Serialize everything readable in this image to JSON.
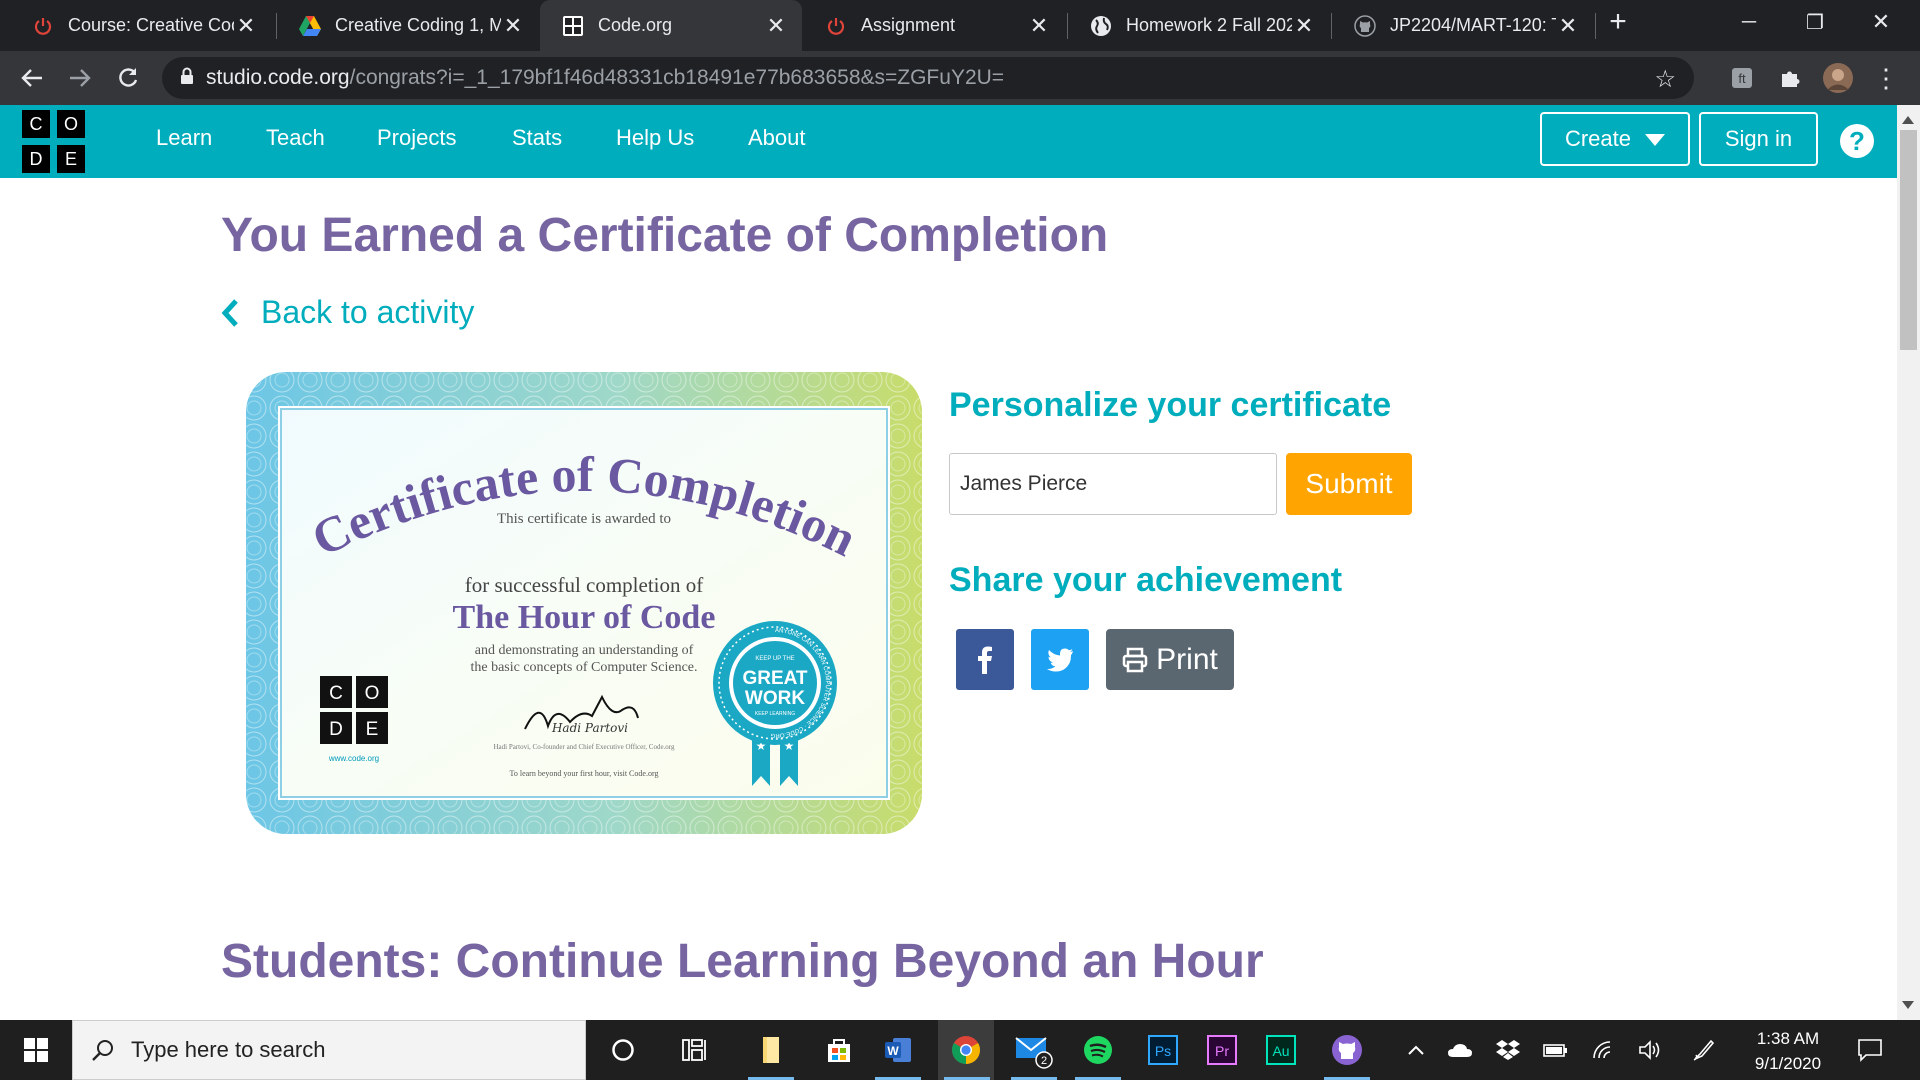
{
  "browser": {
    "tabs": [
      {
        "title": "Course: Creative Cod",
        "icon": "power-icon"
      },
      {
        "title": "Creative Coding 1, M",
        "icon": "google-drive-icon"
      },
      {
        "title": "Code.org",
        "icon": "code-org-icon",
        "active": true
      },
      {
        "title": "Assignment",
        "icon": "power-icon"
      },
      {
        "title": "Homework 2 Fall 202",
        "icon": "globe-icon"
      },
      {
        "title": "JP2204/MART-120: T",
        "icon": "github-icon"
      }
    ],
    "url_host": "studio.code.org",
    "url_path": "/congrats?i=_1_179bf1f46d48331cb18491e77b683658&s=ZGFuY2U="
  },
  "site": {
    "logo_letters": [
      "C",
      "O",
      "D",
      "E"
    ],
    "nav": [
      "Learn",
      "Teach",
      "Projects",
      "Stats",
      "Help Us",
      "About"
    ],
    "create_label": "Create",
    "signin_label": "Sign in",
    "help_label": "?"
  },
  "page": {
    "title": "You Earned a Certificate of Completion",
    "back_label": "Back to activity",
    "certificate": {
      "heading": "Certificate of Completion",
      "awarded": "This certificate is awarded to",
      "for_completion": "for successful completion of",
      "course": "The Hour of Code",
      "demonstrating": "and demonstrating an understanding of",
      "concepts": "the basic concepts of Computer Science.",
      "signature": "Hadi Partovi",
      "signer": "Hadi Partovi, Co-founder and Chief Executive Officer, Code.org",
      "learn_more": "To learn beyond your first hour, visit Code.org",
      "website": "www.code.org",
      "badge_top": "KEEP UP THE",
      "badge_main1": "GREAT",
      "badge_main2": "WORK",
      "badge_bottom": "KEEP LEARNING",
      "badge_ring": "ANYONE CAN LEARN COMPUTER SCIENCE · CODE.ORG"
    },
    "personalize_heading": "Personalize your certificate",
    "name_value": "James Pierce",
    "submit_label": "Submit",
    "share_heading": "Share your achievement",
    "print_label": "Print",
    "students_heading": "Students: Continue Learning Beyond an Hour"
  },
  "taskbar": {
    "search_placeholder": "Type here to search",
    "time": "1:38 AM",
    "date": "9/1/2020",
    "mail_badge": "2",
    "apps": [
      "cortana",
      "task-view",
      "file-explorer",
      "store",
      "word",
      "chrome",
      "mail",
      "spotify",
      "photoshop",
      "premiere",
      "audition",
      "github-desktop"
    ]
  },
  "colors": {
    "brand_teal": "#00adbc",
    "heading_purple": "#7665a0",
    "submit_orange": "#ffa400",
    "facebook": "#3b5998",
    "twitter": "#1da1f2",
    "print_gray": "#5b6770"
  }
}
